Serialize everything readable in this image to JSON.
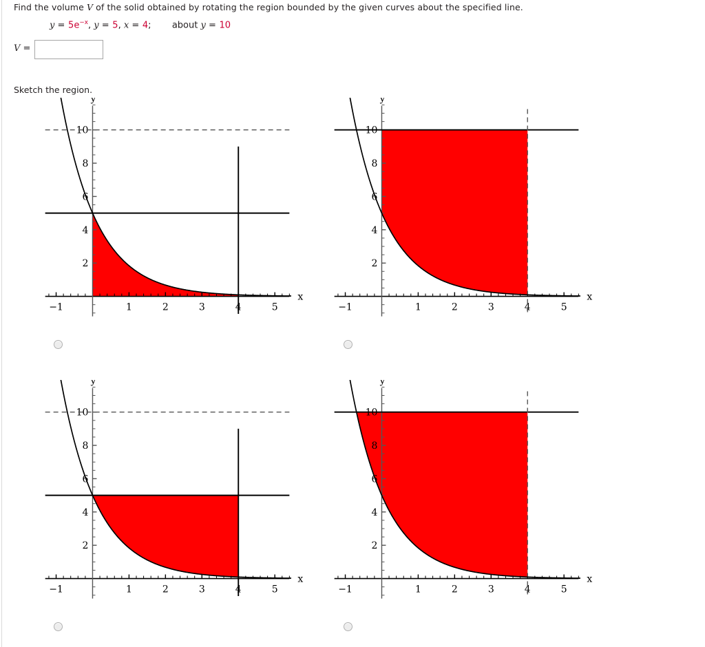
{
  "question": {
    "prompt": "Find the volume V of the solid obtained by rotating the region bounded by the given curves about the specified line.",
    "equation_plain": "y = 5e^{-x}, y = 5, x = 4;   about y = 10",
    "eq_y": "y",
    "eq_eq": "=",
    "eq_curve_coef": "5",
    "eq_curve_base": "e",
    "eq_curve_exp": "−x",
    "eq_comma1": ",",
    "eq_y2": "y",
    "eq_val2": "5",
    "eq_comma2": ",",
    "eq_x": "x",
    "eq_val3": "4",
    "eq_semicolon": ";",
    "eq_about": "about",
    "eq_y3": "y",
    "eq_val4": "10",
    "answer_label": "V =",
    "answer_value": "",
    "answer_placeholder": "",
    "sketch_label": "Sketch the region.",
    "accent_red": "#cc0033",
    "fill_red": "#ff0000"
  },
  "chart_data": [
    {
      "id": "choice-a",
      "type": "area",
      "title": "",
      "xlabel": "x",
      "ylabel": "y",
      "xlim": [
        -1.35,
        5.45
      ],
      "ylim": [
        -1.3,
        11.6
      ],
      "xticks": [
        -1,
        1,
        2,
        3,
        4,
        5
      ],
      "xticklabels": [
        "−1",
        "1",
        "2",
        "3",
        "4",
        "5"
      ],
      "yticks": [
        2,
        4,
        6,
        8,
        10
      ],
      "yticklabels": [
        "2",
        "4",
        "6",
        "8",
        "10"
      ],
      "minor_tick_step": 0.2,
      "grid": false,
      "legend": "none",
      "curve": {
        "expr": "5*exp(-x)",
        "coef": 5,
        "label": "y = 5e^(-x)",
        "style": "solid",
        "color": "#000000"
      },
      "lines": [
        {
          "kind": "horizontal",
          "y": 10,
          "style": "dashed",
          "color": "#555555",
          "label": "y = 10"
        },
        {
          "kind": "horizontal",
          "y": 5,
          "style": "solid",
          "color": "#000000",
          "label": "y = 5"
        },
        {
          "kind": "vertical",
          "x": 4,
          "style": "solid",
          "color": "#000000",
          "label": "x = 4"
        }
      ],
      "shaded_region": {
        "description": "between curve y = 5e^(-x) and y = 0, from x = 0 to x = 4",
        "x_from": 0,
        "x_to": 4,
        "upper": "5*exp(-x)",
        "lower": 0,
        "color": "#ff0000"
      },
      "selected": false
    },
    {
      "id": "choice-b",
      "type": "area",
      "title": "",
      "xlabel": "x",
      "ylabel": "y",
      "xlim": [
        -1.35,
        5.45
      ],
      "ylim": [
        -1.3,
        11.6
      ],
      "xticks": [
        -1,
        1,
        2,
        3,
        4,
        5
      ],
      "xticklabels": [
        "−1",
        "1",
        "2",
        "3",
        "4",
        "5"
      ],
      "yticks": [
        2,
        4,
        6,
        8,
        10
      ],
      "yticklabels": [
        "2",
        "4",
        "6",
        "8",
        "10"
      ],
      "minor_tick_step": 0.2,
      "grid": false,
      "legend": "none",
      "curve": {
        "expr": "5*exp(-x)",
        "coef": 5,
        "label": "y = 5e^(-x)",
        "style": "solid",
        "color": "#000000"
      },
      "lines": [
        {
          "kind": "horizontal",
          "y": 10,
          "style": "solid",
          "color": "#000000",
          "label": "y = 10"
        },
        {
          "kind": "vertical",
          "x": 4,
          "style": "dashed",
          "color": "#555555",
          "label": "x = 4"
        }
      ],
      "shaded_region": {
        "description": "between curve y = 5e^(-x) and y = 10, from x = 0 to x = 4",
        "x_from": 0,
        "x_to": 4,
        "upper": 10,
        "lower": "5*exp(-x)",
        "color": "#ff0000"
      },
      "selected": false
    },
    {
      "id": "choice-c",
      "type": "area",
      "title": "",
      "xlabel": "x",
      "ylabel": "y",
      "xlim": [
        -1.35,
        5.45
      ],
      "ylim": [
        -1.3,
        11.6
      ],
      "xticks": [
        -1,
        1,
        2,
        3,
        4,
        5
      ],
      "xticklabels": [
        "−1",
        "1",
        "2",
        "3",
        "4",
        "5"
      ],
      "yticks": [
        2,
        4,
        6,
        8,
        10
      ],
      "yticklabels": [
        "2",
        "4",
        "6",
        "8",
        "10"
      ],
      "minor_tick_step": 0.2,
      "grid": false,
      "legend": "none",
      "curve": {
        "expr": "5*exp(-x)",
        "coef": 5,
        "label": "y = 5e^(-x)",
        "style": "solid",
        "color": "#000000"
      },
      "lines": [
        {
          "kind": "horizontal",
          "y": 10,
          "style": "dashed",
          "color": "#555555",
          "label": "y = 10"
        },
        {
          "kind": "horizontal",
          "y": 5,
          "style": "solid",
          "color": "#000000",
          "label": "y = 5"
        },
        {
          "kind": "vertical",
          "x": 4,
          "style": "solid",
          "color": "#000000",
          "label": "x = 4"
        }
      ],
      "shaded_region": {
        "description": "between curve y = 5e^(-x) and y = 5, from x = 0 to x = 4",
        "x_from": 0,
        "x_to": 4,
        "upper": 5,
        "lower": "5*exp(-x)",
        "color": "#ff0000"
      },
      "selected": false
    },
    {
      "id": "choice-d",
      "type": "area",
      "title": "",
      "xlabel": "x",
      "ylabel": "y",
      "xlim": [
        -1.35,
        5.45
      ],
      "ylim": [
        -1.3,
        11.6
      ],
      "xticks": [
        -1,
        1,
        2,
        3,
        4,
        5
      ],
      "xticklabels": [
        "−1",
        "1",
        "2",
        "3",
        "4",
        "5"
      ],
      "yticks": [
        2,
        4,
        6,
        8,
        10
      ],
      "yticklabels": [
        "2",
        "4",
        "6",
        "8",
        "10"
      ],
      "minor_tick_step": 0.2,
      "grid": false,
      "legend": "none",
      "curve": {
        "expr": "5*exp(-x)",
        "coef": 5,
        "label": "y = 5e^(-x)",
        "style": "solid",
        "color": "#000000"
      },
      "lines": [
        {
          "kind": "horizontal",
          "y": 10,
          "style": "solid",
          "color": "#000000",
          "label": "y = 10"
        },
        {
          "kind": "vertical",
          "x": 4,
          "style": "dashed",
          "color": "#555555",
          "label": "x = 4"
        }
      ],
      "shaded_region": {
        "description": "between curve y = 5e^(-x) and y = 10, from x = -0.693 to x = 4",
        "x_from": -0.693,
        "x_to": 4,
        "upper": 10,
        "lower": "5*exp(-x)",
        "color": "#ff0000"
      },
      "selected": false
    }
  ]
}
